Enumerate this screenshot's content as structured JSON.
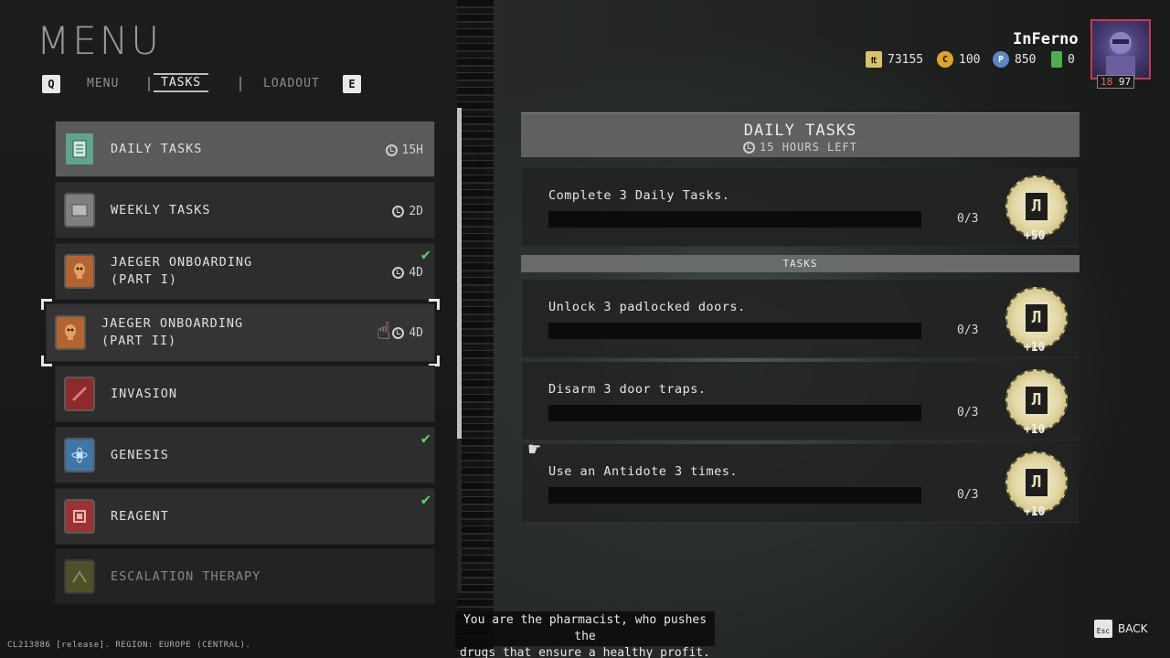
{
  "header": {
    "title": "MENU",
    "left_key": "Q",
    "right_key": "E",
    "tabs": [
      "MENU",
      "TASKS",
      "LOADOUT"
    ],
    "active_tab": "TASKS"
  },
  "player": {
    "name": "InFerno",
    "level": "18",
    "sublevel": "97",
    "currencies": [
      {
        "icon": "ticket-icon",
        "value": "73155",
        "color": "#d9c36a"
      },
      {
        "icon": "gold-coin-icon",
        "value": "100",
        "color": "#e0a526"
      },
      {
        "icon": "blue-coin-icon",
        "value": "850",
        "color": "#5b86c7"
      },
      {
        "icon": "green-token-icon",
        "value": "0",
        "color": "#4fae4f"
      }
    ]
  },
  "task_list": [
    {
      "label": "DAILY TASKS",
      "time": "15H",
      "completed": false,
      "icon": "daily-tasks-icon",
      "color": "#5fa58d"
    },
    {
      "label": "WEEKLY TASKS",
      "time": "2D",
      "completed": false,
      "icon": "weekly-tasks-icon",
      "color": "#8a8a8a"
    },
    {
      "label": "JAEGER ONBOARDING",
      "label2": "(PART I)",
      "time": "4D",
      "completed": true,
      "icon": "jaeger-icon",
      "color": "#c8713a"
    },
    {
      "label": "JAEGER ONBOARDING",
      "label2": "(PART II)",
      "time": "4D",
      "completed": false,
      "icon": "jaeger-icon",
      "color": "#c8713a"
    },
    {
      "label": "INVASION",
      "time": "",
      "completed": false,
      "icon": "invasion-icon",
      "color": "#a23232"
    },
    {
      "label": "GENESIS",
      "time": "",
      "completed": true,
      "icon": "genesis-icon",
      "color": "#4d86b8"
    },
    {
      "label": "REAGENT",
      "time": "",
      "completed": true,
      "icon": "reagent-icon",
      "color": "#b33b3b"
    },
    {
      "label": "ESCALATION THERAPY",
      "time": "",
      "completed": false,
      "icon": "escalation-icon",
      "color": "#8a8d3b"
    }
  ],
  "panel": {
    "title": "DAILY TASKS",
    "subtitle": "15 HOURS LEFT",
    "summary": {
      "text": "Complete 3 Daily Tasks.",
      "count": "0/3",
      "progress": 0,
      "reward": "+50"
    },
    "section_label": "TASKS",
    "tasks": [
      {
        "text": "Unlock 3 padlocked doors.",
        "count": "0/3",
        "progress": 0,
        "reward": "+10"
      },
      {
        "text": "Disarm 3 door traps.",
        "count": "0/3",
        "progress": 0,
        "reward": "+10"
      },
      {
        "text": "Use an Antidote 3 times.",
        "count": "0/3",
        "progress": 0,
        "reward": "+10"
      }
    ]
  },
  "footer": {
    "tooltip_line1": "You are the pharmacist, who pushes the",
    "tooltip_line2": "drugs that ensure a healthy profit.",
    "build": "CL213886 [release]. REGION: EUROPE (CENTRAL).",
    "back_key": "Esc",
    "back_label": "BACK"
  }
}
